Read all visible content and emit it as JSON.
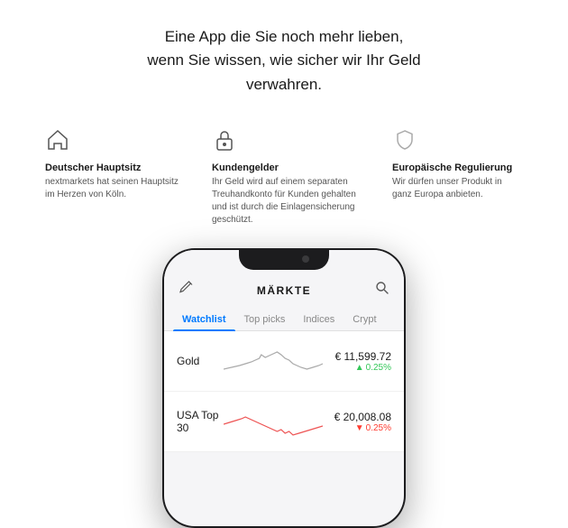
{
  "hero": {
    "line1": "Eine App die Sie noch mehr lieben,",
    "line2": "wenn Sie wissen, wie sicher wir Ihr Geld",
    "line3": "verwahren."
  },
  "features": [
    {
      "id": "hauptsitz",
      "icon": "home",
      "title": "Deutscher Hauptsitz",
      "description": "nextmarkets hat seinen Hauptsitz im Herzen von Köln."
    },
    {
      "id": "kundengelder",
      "icon": "lock",
      "title": "Kundengelder",
      "description": "Ihr Geld wird auf einem separaten Treuhandkonto für Kunden gehalten und ist durch die Einlagensicherung geschützt."
    },
    {
      "id": "regulierung",
      "icon": "shield",
      "title": "Europäische Regulierung",
      "description": "Wir dürfen unser Produkt in ganz Europa anbieten."
    }
  ],
  "app": {
    "title": "MÄRKTE",
    "tabs": [
      {
        "label": "Watchlist",
        "active": true
      },
      {
        "label": "Top picks",
        "active": false
      },
      {
        "label": "Indices",
        "active": false
      },
      {
        "label": "Crypt",
        "active": false
      }
    ],
    "stocks": [
      {
        "name": "Gold",
        "price": "€ 11,599.72",
        "change": "0.25%",
        "direction": "up"
      },
      {
        "name": "USA Top 30",
        "price": "€ 20,008.08",
        "change": "0.25%",
        "direction": "down"
      }
    ]
  },
  "colors": {
    "accent": "#007aff",
    "up": "#34c759",
    "down": "#ff3b30"
  }
}
